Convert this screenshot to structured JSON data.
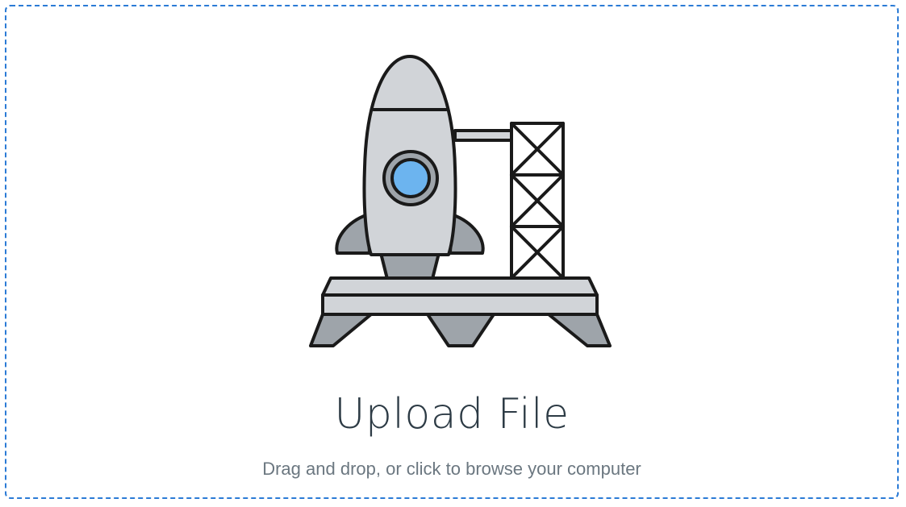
{
  "upload": {
    "title": "Upload File",
    "subtitle": "Drag and drop, or click to browse your computer"
  },
  "colors": {
    "border_accent": "#2b7bd6",
    "illustration_body": "#d1d4d8",
    "illustration_shadow": "#9ea4aa",
    "window_glass": "#6cb4ef",
    "outline": "#1a1a1a",
    "title_text": "#2d3b45",
    "subtitle_text": "#6b7780"
  },
  "icons": {
    "illustration": "rocket-launchpad-icon"
  }
}
